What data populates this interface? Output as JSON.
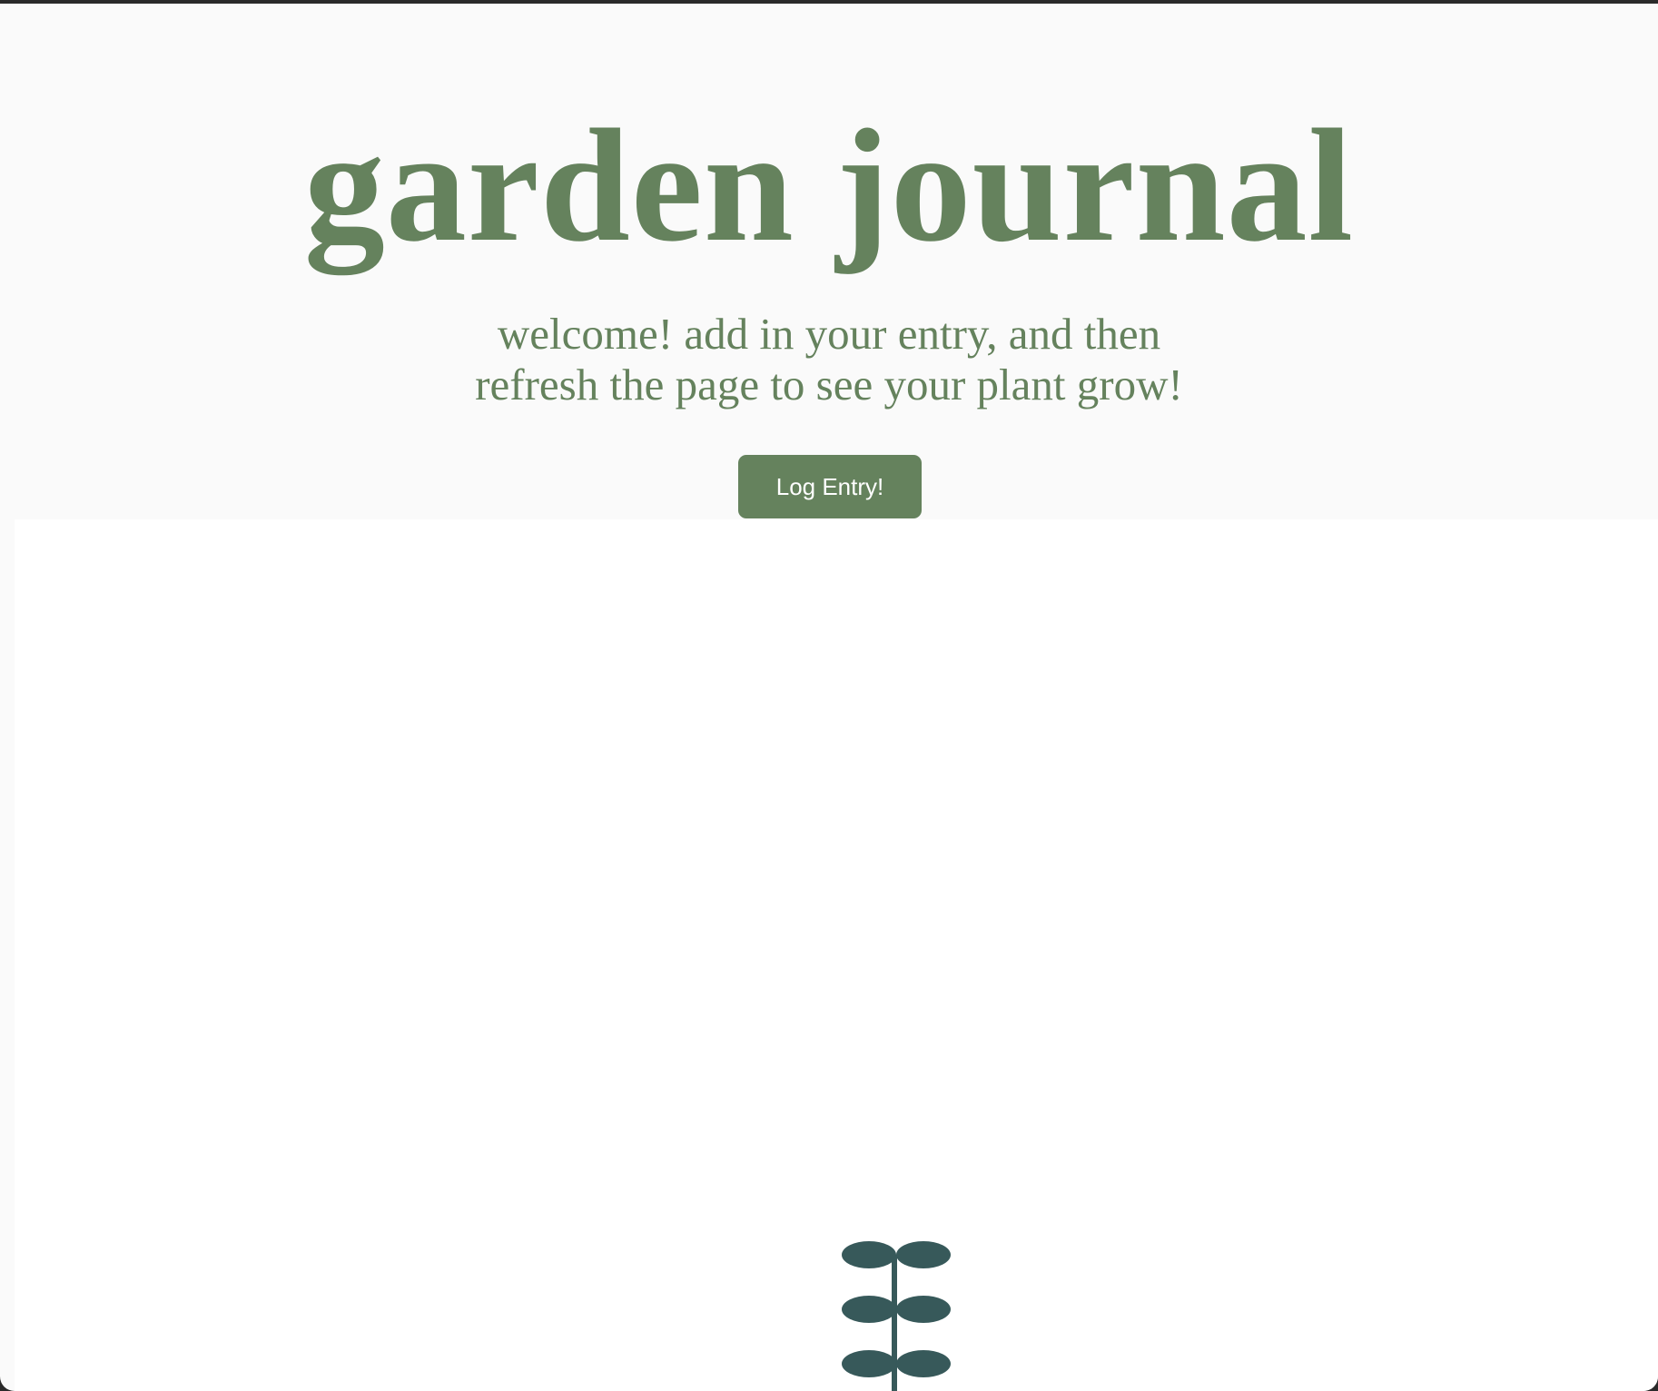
{
  "header": {
    "title": "garden journal",
    "subtitle": "welcome! add in your entry, and then refresh the page to see your plant grow!",
    "log_button_label": "Log Entry!"
  },
  "colors": {
    "text_green": "#65825d",
    "button_green": "#65825d",
    "plant_teal": "#37595a",
    "header_bg": "#fafafa",
    "canvas_bg": "#ffffff"
  },
  "plant": {
    "leaf_pairs": 3
  }
}
